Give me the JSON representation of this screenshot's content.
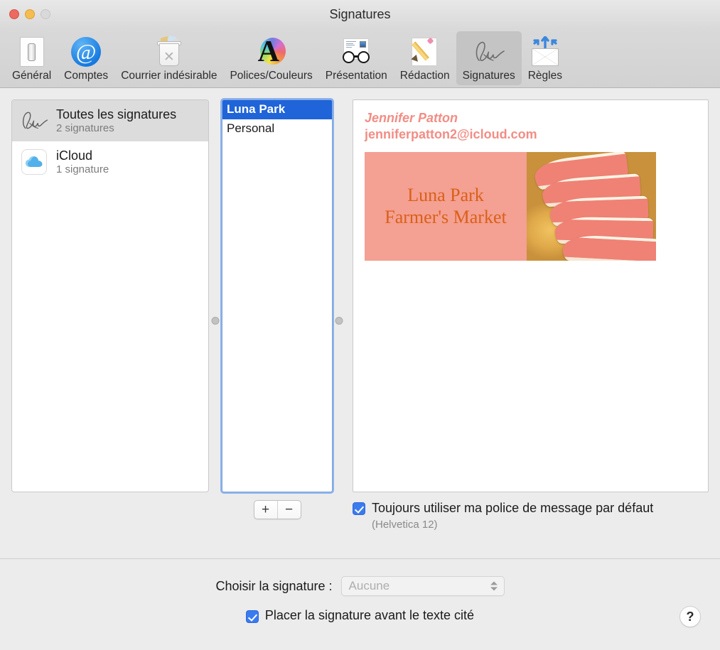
{
  "window": {
    "title": "Signatures",
    "controls": {
      "close": "close-button",
      "minimize": "minimize-button",
      "zoom": "zoom-button"
    }
  },
  "toolbar": {
    "items": [
      {
        "label": "Général",
        "icon": "general-switch-icon",
        "selected": false
      },
      {
        "label": "Comptes",
        "icon": "at-sign-icon",
        "selected": false
      },
      {
        "label": "Courrier indésirable",
        "icon": "junk-trash-icon",
        "selected": false
      },
      {
        "label": "Polices/Couleurs",
        "icon": "fonts-colors-icon",
        "selected": false
      },
      {
        "label": "Présentation",
        "icon": "viewing-glasses-icon",
        "selected": false
      },
      {
        "label": "Rédaction",
        "icon": "composing-pencil-icon",
        "selected": false
      },
      {
        "label": "Signatures",
        "icon": "signature-icon",
        "selected": true
      },
      {
        "label": "Règles",
        "icon": "rules-envelope-icon",
        "selected": false
      }
    ]
  },
  "accounts": {
    "items": [
      {
        "title": "Toutes les signatures",
        "subtitle": "2 signatures",
        "icon": "signature-icon",
        "selected": true
      },
      {
        "title": "iCloud",
        "subtitle": "1 signature",
        "icon": "icloud-icon",
        "selected": false
      }
    ]
  },
  "signature_list": {
    "items": [
      {
        "label": "Luna Park",
        "selected": true
      },
      {
        "label": "Personal",
        "selected": false
      }
    ],
    "add_label": "+",
    "remove_label": "−"
  },
  "preview": {
    "name": "Jennifer Patton",
    "email": "jenniferpatton2@icloud.com",
    "banner": {
      "line1": "Luna Park",
      "line2": "Farmer's Market",
      "bg_color": "#f4a092",
      "text_color": "#d9601a",
      "photo_alt": "grapefruit-photo"
    }
  },
  "default_font": {
    "checkbox_checked": true,
    "label": "Toujours utiliser ma police de message par défaut",
    "sublabel": "(Helvetica 12)"
  },
  "bottom": {
    "choose_label": "Choisir la signature :",
    "choose_value": "Aucune",
    "choose_disabled": true,
    "place_checkbox_checked": true,
    "place_label": "Placer la signature avant le texte cité",
    "help_label": "?"
  },
  "colors": {
    "accent": "#3a7bf0",
    "selection": "#1f64d8",
    "signature_text": "#f28d85",
    "banner_bg": "#f4a092",
    "banner_text": "#d9601a"
  }
}
